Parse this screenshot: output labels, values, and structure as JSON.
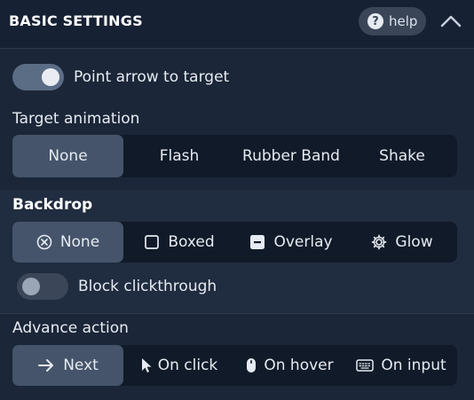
{
  "header": {
    "title": "BASIC SETTINGS",
    "help_label": "help",
    "help_icon": "question-circle-icon",
    "collapse_icon": "chevron-up-icon"
  },
  "point_arrow": {
    "label": "Point arrow to target",
    "enabled": true
  },
  "target_animation": {
    "label": "Target animation",
    "options": [
      "None",
      "Flash",
      "Rubber Band",
      "Shake"
    ],
    "selected": "None"
  },
  "backdrop": {
    "label": "Backdrop",
    "options": [
      {
        "label": "None",
        "icon": "x-circle-icon"
      },
      {
        "label": "Boxed",
        "icon": "square-icon"
      },
      {
        "label": "Overlay",
        "icon": "minus-square-icon"
      },
      {
        "label": "Glow",
        "icon": "gear-icon"
      }
    ],
    "selected": "None"
  },
  "block_clickthrough": {
    "label": "Block clickthrough",
    "enabled": false
  },
  "advance_action": {
    "label": "Advance action",
    "options": [
      {
        "label": "Next",
        "icon": "arrow-right-icon"
      },
      {
        "label": "On click",
        "icon": "cursor-icon"
      },
      {
        "label": "On hover",
        "icon": "mouse-icon"
      },
      {
        "label": "On input",
        "icon": "keyboard-icon"
      }
    ],
    "selected": "Next"
  },
  "colors": {
    "background": "#1b2638",
    "segment_bg": "#111a28",
    "segment_active": "#45546a",
    "toggle_on": "#5b6c85"
  }
}
